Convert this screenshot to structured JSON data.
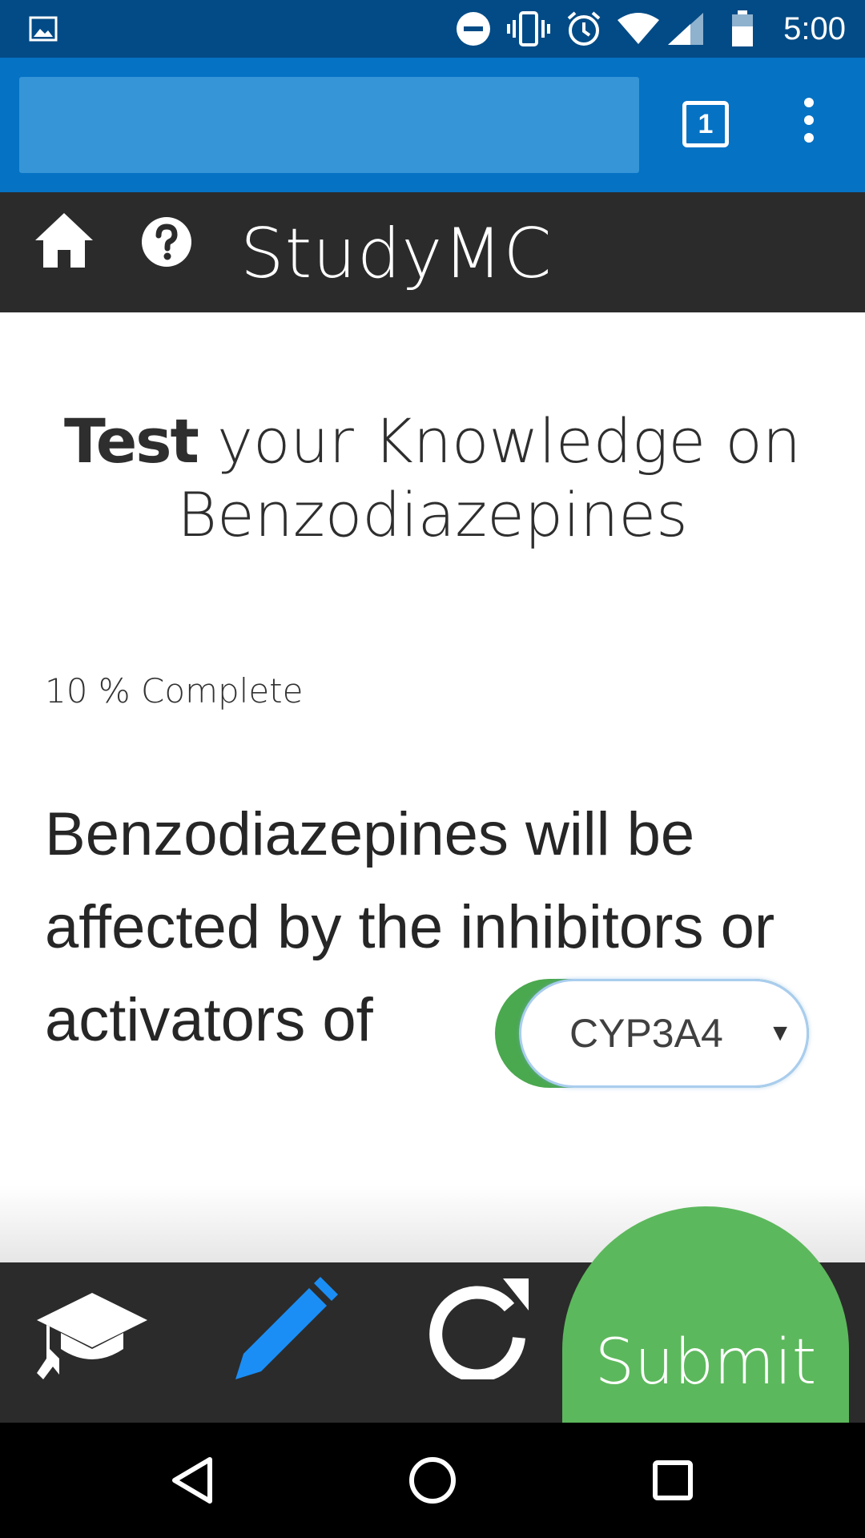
{
  "status_bar": {
    "time": "5:00",
    "icons": [
      "image-icon",
      "do-not-disturb-icon",
      "vibrate-icon",
      "alarm-icon",
      "wifi-icon",
      "signal-icon",
      "battery-icon"
    ]
  },
  "browser": {
    "url_value": "",
    "tab_count": "1",
    "icons": [
      "tabs-icon",
      "more-vert-icon"
    ]
  },
  "app_header": {
    "title": "StudyMC",
    "icons": [
      "home-icon",
      "help-icon"
    ]
  },
  "quiz": {
    "heading_strong": "Test",
    "heading_rest": " your Knowledge on Benzodiazepines",
    "progress_text": "10 % Complete",
    "progress_percent": 10,
    "question_text": "Benzodiazepines will be affected by the inhibitors or activators of",
    "answer_selected": "CYP3A4"
  },
  "toolbar": {
    "icons": [
      "graduation-cap-icon",
      "pencil-icon",
      "refresh-icon"
    ],
    "active_color": "#1a8ef5",
    "submit_label": "Submit",
    "submit_color": "#5cb85c"
  },
  "nav_bar": {
    "icons": [
      "back-icon",
      "home-circle-icon",
      "recents-icon"
    ]
  },
  "colors": {
    "status_bar": "#034b86",
    "browser_bar": "#0572c4",
    "app_header": "#2b2b2b"
  }
}
